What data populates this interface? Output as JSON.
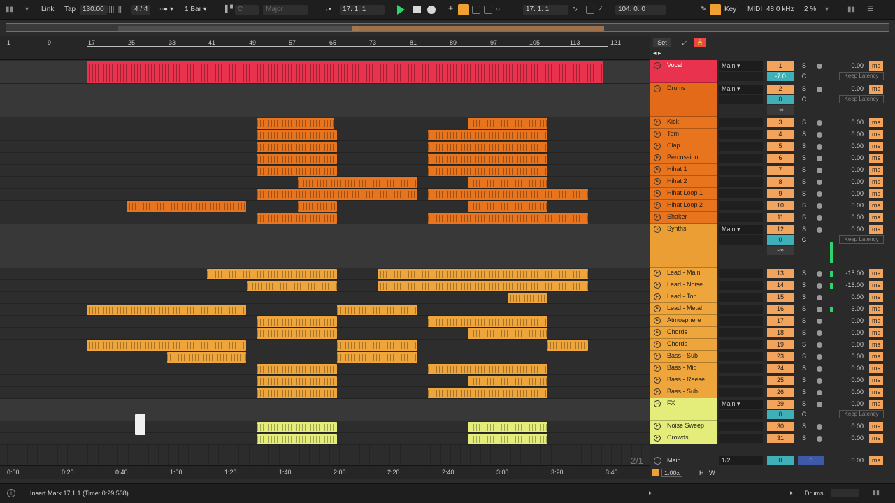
{
  "topbar": {
    "link": "Link",
    "tap": "Tap",
    "tempo": "130.00",
    "meter_icon": "|||| |||",
    "signature": "4 / 4",
    "metronome": "○● ▾",
    "quantize": "1 Bar ▾",
    "scale_root": "C",
    "scale_mode": "Major",
    "position": "17.    1.    1",
    "loop_start": "17.    1.    1",
    "loop_length": "104.    0.    0",
    "key": "Key",
    "midi": "MIDI",
    "sample_rate": "48.0 kHz",
    "cpu": "2 %"
  },
  "ruler": {
    "bars": [
      "1",
      "9",
      "17",
      "25",
      "33",
      "41",
      "49",
      "57",
      "65",
      "73",
      "81",
      "89",
      "97",
      "105",
      "113",
      "121"
    ]
  },
  "time_ruler": {
    "times": [
      "0:00",
      "0:20",
      "0:40",
      "1:00",
      "1:20",
      "1:40",
      "2:00",
      "2:20",
      "2:40",
      "3:00",
      "3:20",
      "3:40"
    ]
  },
  "page_indicator": "2/1",
  "mixer": {
    "set_label": "Set",
    "main_label": "Main",
    "tracks": [
      {
        "name": "Vocal",
        "route": "Main",
        "num": "1",
        "s": "S",
        "vol": "0.00",
        "ms": "ms",
        "pan": "-7.0",
        "c": "C",
        "keep": "Keep Latency",
        "color": "#e8324e",
        "text": "#ffffff"
      },
      {
        "name": "Drums",
        "route": "Main",
        "num": "2",
        "s": "S",
        "vol": "0.00",
        "ms": "ms",
        "pan": "0",
        "c": "C",
        "keep": "Keep Latency",
        "minus": "-∞",
        "color": "#e26a18",
        "text": "#1d1d1d"
      },
      {
        "name": "Kick",
        "num": "3",
        "s": "S",
        "vol": "0.00",
        "ms": "ms",
        "color": "#e8741e"
      },
      {
        "name": "Tom",
        "num": "4",
        "s": "S",
        "vol": "0.00",
        "ms": "ms",
        "color": "#e8741e"
      },
      {
        "name": "Clap",
        "num": "5",
        "s": "S",
        "vol": "0.00",
        "ms": "ms",
        "color": "#e8741e"
      },
      {
        "name": "Percussion",
        "num": "6",
        "s": "S",
        "vol": "0.00",
        "ms": "ms",
        "color": "#e8741e"
      },
      {
        "name": "Hihat 1",
        "num": "7",
        "s": "S",
        "vol": "0.00",
        "ms": "ms",
        "color": "#e8741e"
      },
      {
        "name": "Hihat 2",
        "num": "8",
        "s": "S",
        "vol": "0.00",
        "ms": "ms",
        "color": "#e8741e"
      },
      {
        "name": "Hihat Loop 1",
        "num": "9",
        "s": "S",
        "vol": "0.00",
        "ms": "ms",
        "color": "#e8741e"
      },
      {
        "name": "Hihat Loop 2",
        "num": "10",
        "s": "S",
        "vol": "0.00",
        "ms": "ms",
        "color": "#e8741e"
      },
      {
        "name": "Shaker",
        "num": "11",
        "s": "S",
        "vol": "0.00",
        "ms": "ms",
        "color": "#e8741e"
      },
      {
        "name": "Synths",
        "route": "Main",
        "num": "12",
        "s": "S",
        "vol": "0.00",
        "ms": "ms",
        "pan": "0",
        "c": "C",
        "keep": "Keep Latency",
        "minus": "-∞",
        "color": "#ea9e34",
        "text": "#1d1d1d"
      },
      {
        "name": "Lead - Main",
        "num": "13",
        "s": "S",
        "vol": "-15.00",
        "ms": "ms",
        "color": "#eea63c"
      },
      {
        "name": "Lead - Noise",
        "num": "14",
        "s": "S",
        "vol": "-16.00",
        "ms": "ms",
        "color": "#eea63c"
      },
      {
        "name": "Lead - Top",
        "num": "15",
        "s": "S",
        "vol": "0.00",
        "ms": "ms",
        "color": "#eea63c"
      },
      {
        "name": "Lead - Metal",
        "num": "16",
        "s": "S",
        "vol": "-6.00",
        "ms": "ms",
        "color": "#eea63c"
      },
      {
        "name": "Atmosphere",
        "num": "17",
        "s": "S",
        "vol": "0.00",
        "ms": "ms",
        "color": "#eea63c"
      },
      {
        "name": "Chords",
        "num": "18",
        "s": "S",
        "vol": "0.00",
        "ms": "ms",
        "color": "#eea63c"
      },
      {
        "name": "Chords",
        "num": "19",
        "s": "S",
        "vol": "0.00",
        "ms": "ms",
        "color": "#eea63c"
      },
      {
        "name": "Bass - Sub",
        "num": "23",
        "s": "S",
        "vol": "0.00",
        "ms": "ms",
        "color": "#eea63c"
      },
      {
        "name": "Bass - Mid",
        "num": "24",
        "s": "S",
        "vol": "0.00",
        "ms": "ms",
        "color": "#eea63c"
      },
      {
        "name": "Bass - Reese",
        "num": "25",
        "s": "S",
        "vol": "0.00",
        "ms": "ms",
        "color": "#eea63c"
      },
      {
        "name": "Bass - Sub",
        "num": "26",
        "s": "S",
        "vol": "0.00",
        "ms": "ms",
        "color": "#eea63c"
      },
      {
        "name": "FX",
        "route": "Main",
        "num": "29",
        "s": "S",
        "vol": "0.00",
        "ms": "ms",
        "pan": "0",
        "c": "C",
        "keep": "Keep Latency",
        "color": "#e4ec7a",
        "text": "#1d1d1d"
      },
      {
        "name": "Noise Sweep",
        "num": "30",
        "s": "S",
        "vol": "0.00",
        "ms": "ms",
        "color": "#e4ec7a"
      },
      {
        "name": "Crowds",
        "num": "31",
        "s": "S",
        "vol": "0.00",
        "ms": "ms",
        "color": "#e4ec7a"
      }
    ],
    "master": {
      "name": "Main",
      "route": "1/2",
      "num": "0",
      "cue": "0",
      "vol": "0.00",
      "ms": "ms",
      "zoom": "1.00x",
      "h": "H",
      "w": "W"
    }
  },
  "status": {
    "message": "Insert Mark 17.1.1 (Time: 0:29:538)",
    "track": "Drums"
  }
}
